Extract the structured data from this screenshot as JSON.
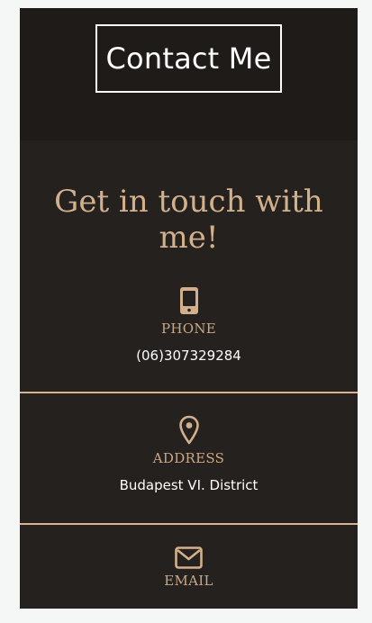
{
  "page": {
    "title": "Contact Me"
  },
  "contact": {
    "headline": "Get in touch with me!",
    "items": [
      {
        "icon": "mobile-phone-icon",
        "label": "PHONE",
        "value": "(06)307329284"
      },
      {
        "icon": "map-pin-icon",
        "label": "ADDRESS",
        "value": "Budapest VI. District"
      },
      {
        "icon": "envelope-icon",
        "label": "EMAIL"
      }
    ]
  },
  "colors": {
    "header_bg": "#1e1b19",
    "section_bg": "#24211f",
    "accent": "#d2b08c",
    "text": "#ffffff"
  }
}
